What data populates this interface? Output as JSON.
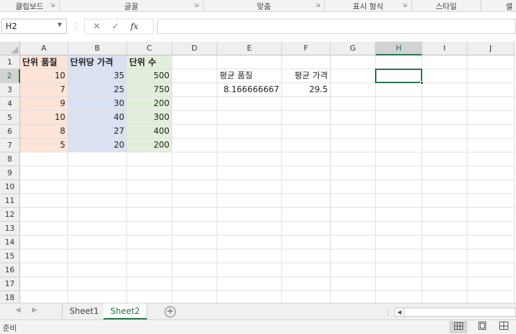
{
  "ribbon_groups": [
    {
      "label": "클립보드"
    },
    {
      "label": "글꼴"
    },
    {
      "label": "맞춤"
    },
    {
      "label": "표시 형식"
    },
    {
      "label": "스타일"
    },
    {
      "label": "셀"
    }
  ],
  "formula_bar": {
    "name_box": "H2",
    "cancel_icon": "✕",
    "enter_icon": "✓",
    "fx_label": "fx",
    "formula": ""
  },
  "columns": [
    "A",
    "B",
    "C",
    "D",
    "E",
    "F",
    "G",
    "H",
    "I",
    "J"
  ],
  "selected_column": "H",
  "rows": [
    "1",
    "2",
    "3",
    "4",
    "5",
    "6",
    "7",
    "8",
    "9",
    "10",
    "11",
    "12",
    "13",
    "14",
    "15",
    "16",
    "17",
    "18"
  ],
  "selected_row": "2",
  "cells": {
    "A1": "단위 품질",
    "B1": "단위당 가격",
    "C1": "단위 수",
    "A2": "10",
    "B2": "35",
    "C2": "500",
    "A3": "7",
    "B3": "25",
    "C3": "750",
    "A4": "9",
    "B4": "30",
    "C4": "200",
    "A5": "10",
    "B5": "40",
    "C5": "300",
    "A6": "8",
    "B6": "27",
    "C6": "400",
    "A7": "5",
    "B7": "20",
    "C7": "200",
    "E2": "평균 품질",
    "F2": "평균 가격",
    "E3": "8.166666667",
    "F3": "29.5"
  },
  "fill_colors": {
    "A": "#fce4d6",
    "B": "#d9e1f2",
    "C": "#e2efda"
  },
  "accent_color": "#217346",
  "sheets": [
    {
      "label": "Sheet1",
      "active": false
    },
    {
      "label": "Sheet2",
      "active": true
    }
  ],
  "add_sheet_icon": "+",
  "status_bar": {
    "ready": "준비"
  },
  "view_icons": [
    "normal-view-icon",
    "page-layout-icon",
    "page-break-icon"
  ]
}
